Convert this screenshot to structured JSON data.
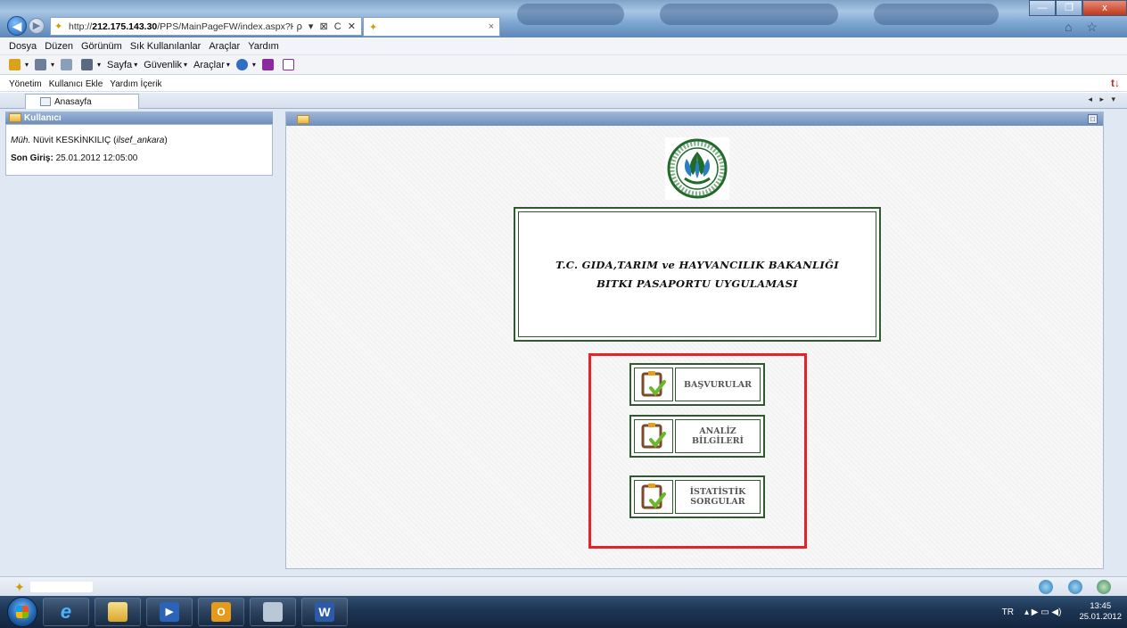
{
  "browser": {
    "url_prefix": "http://",
    "url_host": "212.175.143.30",
    "url_path": "/PPS/MainPageFW/index.aspx?HideMenu",
    "address_controls": "ρ ▾ ⊠ C ✕",
    "tab_close": "×",
    "window_minimize": "—",
    "window_restore": "❐",
    "window_close": "x",
    "toolbar_icons": "⌂ ☆ ⚙"
  },
  "menubar": {
    "items": [
      "Dosya",
      "Düzen",
      "Görünüm",
      "Sık Kullanılanlar",
      "Araçlar",
      "Yardım"
    ]
  },
  "commandbar": {
    "home_caret": "▾",
    "feeds_caret": "▾",
    "print_caret": "▾",
    "page": "Sayfa",
    "safety": "Güvenlik",
    "tools": "Araçlar",
    "help_caret": "▾",
    "colors": {
      "home": "#d9a21a",
      "feeds": "#6d7f99",
      "mail": "#8aa0b8",
      "print": "#5a6a80",
      "help": "#2f6fc2",
      "onenote1": "#8a2a9e",
      "onenote2": "#8a2a9e"
    }
  },
  "app_toolbar": {
    "items": [
      "Yönetim",
      "Kullanıcı Ekle",
      "Yardım İçerik"
    ],
    "right_icon": "t↓"
  },
  "tabs": {
    "home_label": "Anasayfa",
    "nav": "◂ ▸ ▾"
  },
  "user_panel": {
    "title": "Kullanıcı",
    "title_prefix": "Müh.",
    "name": "Nüvit KESKİNKILIÇ",
    "username_open": "(",
    "username": "ilsef_ankara",
    "username_close": ")",
    "last_login_label": "Son Giriş:",
    "last_login_value": "25.01.2012 12:05:00"
  },
  "content_panel": {
    "maximize_glyph": "□"
  },
  "banner": {
    "line1": "T.C. GIDA,TARIM ve HAYVANCILIK BAKANLIĞI",
    "line2": "BITKI PASAPORTU UYGULAMASI"
  },
  "menu_buttons": [
    {
      "label": "BAŞVURULAR"
    },
    {
      "label": "ANALİZ\nBİLGİLERİ"
    },
    {
      "label": "İSTATİSTİK\nSORGULAR"
    }
  ],
  "taskbar": {
    "lang": "TR",
    "tray_icons": "▴  ▶  ▭  ◀)",
    "time": "13:45",
    "date": "25.01.2012"
  },
  "colors": {
    "red_highlight": "#e0262b",
    "green_border": "#2e5a2e",
    "panel_header": "#6d8fbd"
  }
}
